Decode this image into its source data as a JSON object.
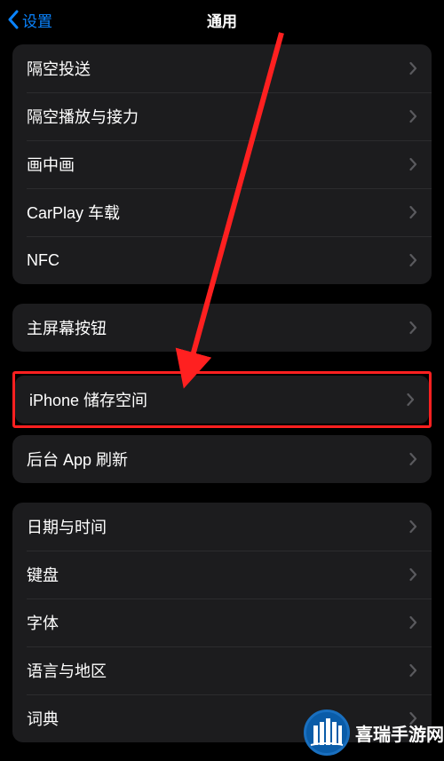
{
  "header": {
    "back_label": "设置",
    "title": "通用"
  },
  "group1": {
    "items": [
      {
        "label": "隔空投送"
      },
      {
        "label": "隔空播放与接力"
      },
      {
        "label": "画中画"
      },
      {
        "label": "CarPlay 车载"
      },
      {
        "label": "NFC"
      }
    ]
  },
  "group2": {
    "items": [
      {
        "label": "主屏幕按钮"
      }
    ]
  },
  "highlighted": {
    "label": "iPhone 储存空间"
  },
  "group3": {
    "items": [
      {
        "label": "后台 App 刷新"
      }
    ]
  },
  "group4": {
    "items": [
      {
        "label": "日期与时间"
      },
      {
        "label": "键盘"
      },
      {
        "label": "字体"
      },
      {
        "label": "语言与地区"
      },
      {
        "label": "词典"
      }
    ]
  },
  "watermark": {
    "text": "喜瑞手游网"
  },
  "annotation": {
    "highlight_color": "#ff2020"
  }
}
